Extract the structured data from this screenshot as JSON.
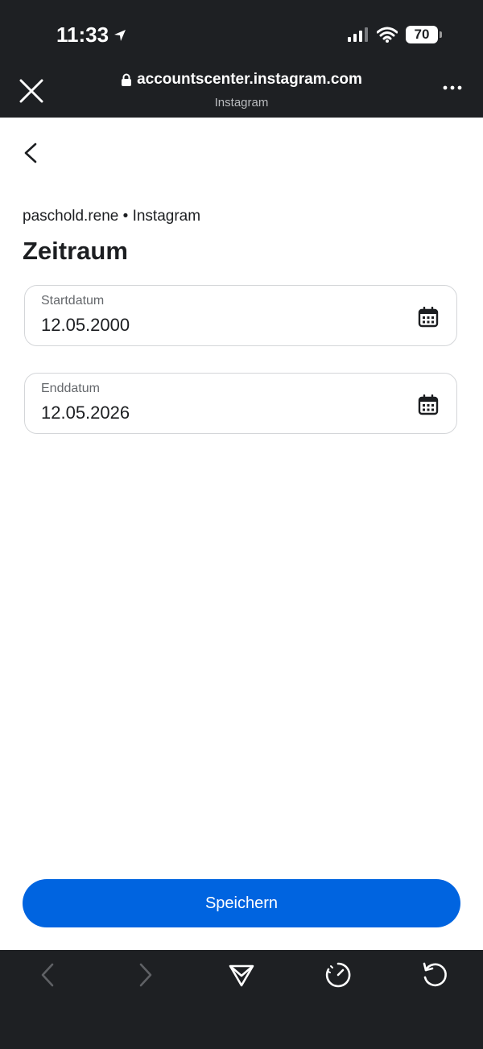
{
  "status_bar": {
    "time": "11:33",
    "battery": "70"
  },
  "browser": {
    "url": "accountscenter.instagram.com",
    "site_name": "Instagram"
  },
  "page": {
    "account_line": "paschold.rene • Instagram",
    "title": "Zeitraum"
  },
  "fields": {
    "start": {
      "label": "Startdatum",
      "value": "12.05.2000"
    },
    "end": {
      "label": "Enddatum",
      "value": "12.05.2026"
    }
  },
  "save_button": "Speichern",
  "colors": {
    "chrome_bg": "#1e2023",
    "primary": "#0064e0",
    "text": "#1c1e21",
    "muted": "#65686c",
    "border": "#d4d6d9"
  },
  "icons": [
    "location-arrow-icon",
    "cellular-signal-icon",
    "wifi-icon",
    "battery-icon",
    "close-icon",
    "lock-icon",
    "more-icon",
    "back-chevron-icon",
    "calendar-icon",
    "nav-back-icon",
    "nav-forward-icon",
    "share-icon",
    "speed-icon",
    "reload-icon"
  ]
}
